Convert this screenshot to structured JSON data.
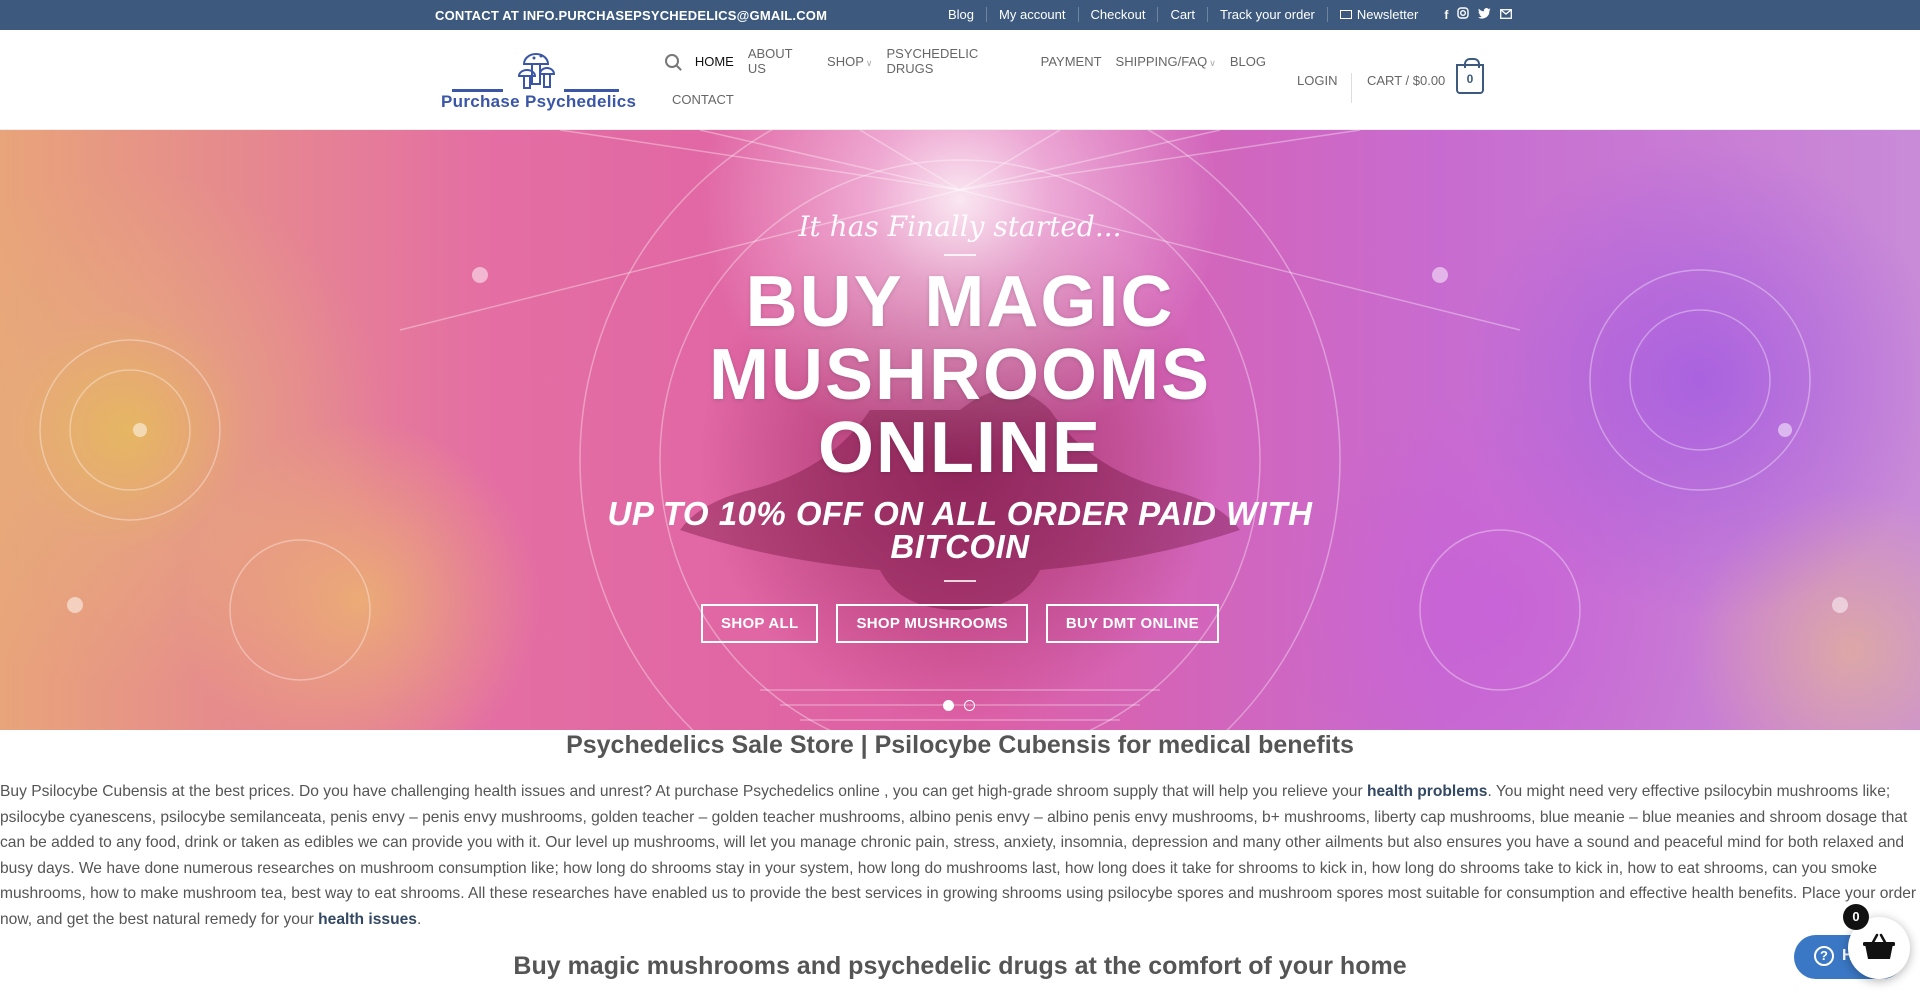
{
  "topbar": {
    "contact": "CONTACT AT INFO.PURCHASEPSYCHEDELICS@GMAIL.COM",
    "links": [
      "Blog",
      "My account",
      "Checkout",
      "Cart",
      "Track your order"
    ],
    "newsletter": "Newsletter",
    "social_icons": [
      "facebook-icon",
      "instagram-icon",
      "twitter-icon",
      "email-icon"
    ]
  },
  "header": {
    "logo_text": "Purchase Psychedelics",
    "nav": [
      "HOME",
      "ABOUT US",
      "SHOP",
      "PSYCHEDELIC DRUGS",
      "PAYMENT",
      "SHIPPING/FAQ",
      "BLOG"
    ],
    "nav_row2": [
      "CONTACT"
    ],
    "login": "LOGIN",
    "cart": "CART / $0.00",
    "cart_count": "0"
  },
  "hero": {
    "subtitle": "It has Finally started...",
    "title_line1": "BUY MAGIC",
    "title_line2": "MUSHROOMS",
    "title_line3": "ONLINE",
    "offer_line1": "UP TO 10% OFF ON ALL ORDER PAID WITH",
    "offer_line2": "BITCOIN",
    "buttons": [
      "SHOP ALL",
      "SHOP MUSHROOMS",
      "BUY DMT ONLINE"
    ]
  },
  "content": {
    "heading1": "Psychedelics Sale Store | Psilocybe Cubensis for medical benefits",
    "para_part1": "Buy Psilocybe Cubensis at the best prices. Do you have challenging health issues and unrest? At purchase Psychedelics online , you can get high-grade shroom supply that will help you relieve your ",
    "para_link1": "health problems",
    "para_part2": ". You might need very effective psilocybin mushrooms like; psilocybe cyanescens, psilocybe semilanceata, penis envy – penis envy mushrooms, golden teacher – golden teacher mushrooms, albino penis envy – albino penis envy mushrooms, b+ mushrooms, liberty cap mushrooms, blue meanie – blue meanies and shroom dosage that can be added to any food, drink or taken as edibles we can provide you with it. Our level up mushrooms,  will let you manage chronic pain, stress, anxiety, insomnia, depression and many other ailments but also ensures you have a sound and peaceful mind for both relaxed and busy days. We have done numerous researches on mushroom consumption like; how long do shrooms stay in your system, how long do mushrooms last, how long does it take for shrooms to kick in, how long do shrooms take to kick in, how to eat shrooms, can you smoke mushrooms, how to make mushroom tea, best way to eat shrooms. All these researches have enabled us to provide the best services in growing shrooms using psilocybe spores and mushroom spores most suitable for consumption and effective health benefits. Place your order now, and get the best natural remedy for your ",
    "para_link2": "health issues",
    "para_part3": ".",
    "heading2": "Buy magic mushrooms and psychedelic drugs at the comfort of your home"
  },
  "widgets": {
    "help_label": "Help",
    "basket_count": "0"
  }
}
